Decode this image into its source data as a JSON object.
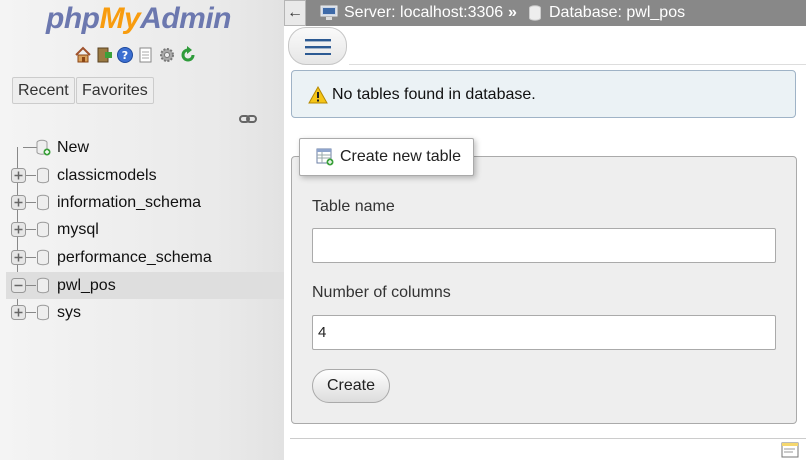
{
  "logo": {
    "php": "php",
    "my": "My",
    "admin": "Admin"
  },
  "quick_icons": [
    "home-icon",
    "logout-icon",
    "help-icon",
    "docs-icon",
    "settings-icon",
    "reload-icon"
  ],
  "nav": {
    "recent": "Recent",
    "favorites": "Favorites"
  },
  "tree": {
    "items": [
      {
        "label": "New",
        "control": "none"
      },
      {
        "label": "classicmodels",
        "control": "expand"
      },
      {
        "label": "information_schema",
        "control": "expand"
      },
      {
        "label": "mysql",
        "control": "expand"
      },
      {
        "label": "performance_schema",
        "control": "expand"
      },
      {
        "label": "pwl_pos",
        "control": "collapse",
        "selected": true
      },
      {
        "label": "sys",
        "control": "expand"
      }
    ]
  },
  "breadcrumb": {
    "back": "←",
    "server": "Server: localhost:3306",
    "separator": "»",
    "database": "Database: pwl_pos"
  },
  "notice": {
    "text": "No tables found in database."
  },
  "create_table": {
    "legend": "Create new table",
    "table_name_label": "Table name",
    "table_name_value": "",
    "columns_label": "Number of columns",
    "columns_value": "4",
    "submit": "Create"
  },
  "colors": {
    "accent_blue": "#6c78af",
    "accent_orange": "#f89c0e",
    "topbar": "#888888",
    "notice_bg": "#ebf2f5"
  }
}
